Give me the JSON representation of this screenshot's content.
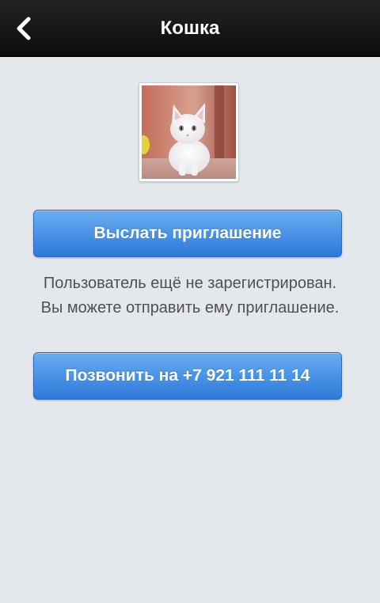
{
  "header": {
    "title": "Кошка",
    "back_icon": "chevron-left-icon"
  },
  "profile": {
    "avatar_description": "white cat photo"
  },
  "actions": {
    "invite_label": "Выслать приглашение",
    "call_label": "Позвонить на +7 921 111 11 14"
  },
  "message": {
    "line1": "Пользователь ещё не зарегистрирован.",
    "line2": "Вы можете отправить ему приглашение."
  },
  "colors": {
    "navbar": "#111111",
    "background": "#e4e7ec",
    "button": "#4a93e6",
    "text": "#4e5054"
  }
}
